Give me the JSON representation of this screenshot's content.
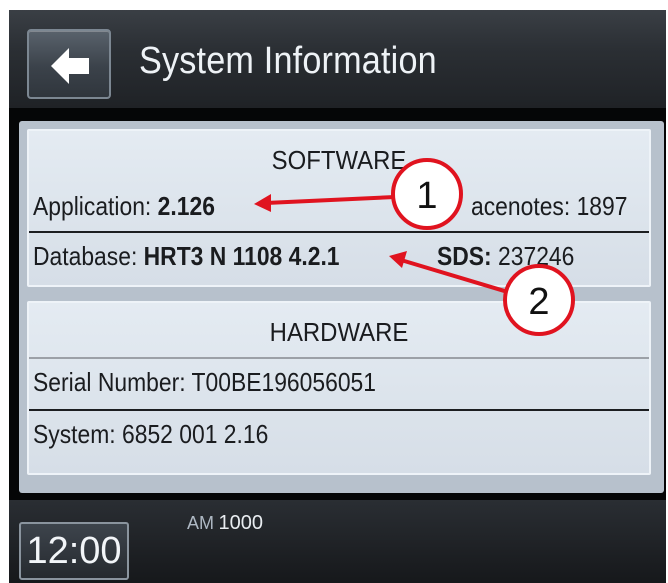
{
  "header": {
    "back_label": "back",
    "title": "System Information"
  },
  "software": {
    "heading": "SOFTWARE",
    "application_label": "Application: ",
    "application_value": "2.126",
    "tracenotes_label": "acenotes: ",
    "tracenotes_value": "1897",
    "database_label": "Database: ",
    "database_value": "HRT3 N 1108 4.2.1",
    "sds_label": "SDS: ",
    "sds_value": "237246"
  },
  "hardware": {
    "heading": "HARDWARE",
    "serial_label": "Serial Number: ",
    "serial_value": "T00BE196056051",
    "system_label": "System: ",
    "system_value": "6852 001 2.16"
  },
  "annotations": [
    {
      "number": "1"
    },
    {
      "number": "2"
    }
  ],
  "footer": {
    "clock": "12:00",
    "band": "AM",
    "frequency": "1000"
  },
  "colors": {
    "annotation_red": "#e0131f",
    "panel_background": "#dde4ec",
    "header_background": "#2b2f34"
  },
  "icons": [
    "back-arrow-icon"
  ]
}
